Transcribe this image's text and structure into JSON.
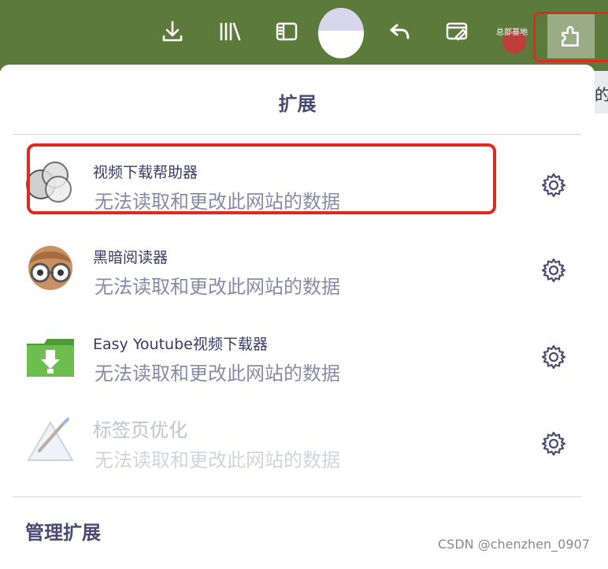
{
  "toolbar": {
    "buttons": [
      {
        "name": "download-button",
        "icon": "download-icon"
      },
      {
        "name": "library-button",
        "icon": "library-icon"
      },
      {
        "name": "sidebar-button",
        "icon": "sidebar-icon"
      },
      {
        "name": "account-avatar-button",
        "icon": "avatar"
      },
      {
        "name": "back-button",
        "icon": "undo-arrow-icon"
      },
      {
        "name": "screenshot-button",
        "icon": "screenshot-edit-icon"
      },
      {
        "name": "extensions-button",
        "icon": "puzzle-piece-icon"
      }
    ],
    "badge_label": "总部基地",
    "colors": {
      "bar": "#5c7a3a",
      "icon": "#ffffff",
      "highlight": "#e12a1f"
    }
  },
  "side_strip_text": "的",
  "panel": {
    "title": "扩展",
    "manage_label": "管理扩展",
    "extensions": [
      {
        "name": "视频下载帮助器",
        "desc": "无法读取和更改此网站的数据",
        "icon": "video-downloadhelper-icon",
        "enabled": true,
        "highlighted": true
      },
      {
        "name": "黑暗阅读器",
        "desc": "无法读取和更改此网站的数据",
        "icon": "dark-reader-icon",
        "enabled": true,
        "highlighted": false
      },
      {
        "name": "Easy Youtube视频下载器",
        "desc": "无法读取和更改此网站的数据",
        "icon": "easy-youtube-downloader-icon",
        "enabled": true,
        "highlighted": false
      },
      {
        "name": "标签页优化",
        "desc": "无法读取和更改此网站的数据",
        "icon": "tab-optimizer-icon",
        "enabled": false,
        "highlighted": false
      }
    ],
    "colors": {
      "title": "#4b4a74",
      "desc": "#8a89a8",
      "disabled": "#c2c3d0"
    }
  },
  "watermark": "CSDN @chenzhen_0907"
}
